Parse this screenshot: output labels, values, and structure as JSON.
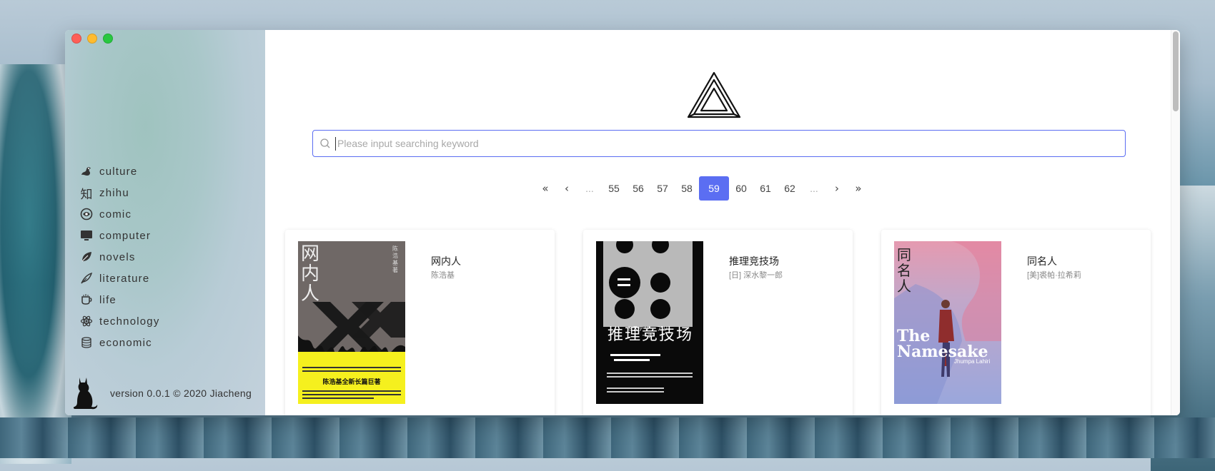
{
  "sidebar": {
    "items": [
      {
        "label": "culture",
        "icon": "dragon-icon"
      },
      {
        "label": "zhihu",
        "icon": "zhi-icon"
      },
      {
        "label": "comic",
        "icon": "comic-icon"
      },
      {
        "label": "computer",
        "icon": "computer-icon"
      },
      {
        "label": "novels",
        "icon": "leaf-icon"
      },
      {
        "label": "literature",
        "icon": "quill-icon"
      },
      {
        "label": "life",
        "icon": "cup-icon"
      },
      {
        "label": "technology",
        "icon": "atom-icon"
      },
      {
        "label": "economic",
        "icon": "coins-icon"
      }
    ],
    "zhi_glyph": "知",
    "version": "version 0.0.1 © 2020 Jiacheng"
  },
  "search": {
    "placeholder": "Please input searching keyword",
    "value": ""
  },
  "pagination": {
    "first": "«",
    "prev": "‹",
    "ellipsis_left": "...",
    "pages": [
      "55",
      "56",
      "57",
      "58",
      "59",
      "60",
      "61",
      "62"
    ],
    "current": "59",
    "ellipsis_right": "...",
    "next": "›",
    "last": "»"
  },
  "books": [
    {
      "title": "网内人",
      "author": "陈浩基",
      "cover_text": {
        "main": "网内人",
        "side": "陈浩基 著",
        "banner": "陈浩基全新长篇巨著"
      }
    },
    {
      "title": "推理竞技场",
      "author": "[日] 深水黎一郎",
      "cover_text": {
        "main": "推理竞技场",
        "small": "ミステリー アリーナ"
      }
    },
    {
      "title": "同名人",
      "author": "[美]裘帕·拉希莉",
      "cover_text": {
        "main": "同名人",
        "en": "The Namesake",
        "en_author": "Jhumpa Lahiri"
      }
    }
  ],
  "colors": {
    "accent": "#5b6ef2",
    "traffic_red": "#fe5f57",
    "traffic_yellow": "#febc2e",
    "traffic_green": "#28c840"
  }
}
